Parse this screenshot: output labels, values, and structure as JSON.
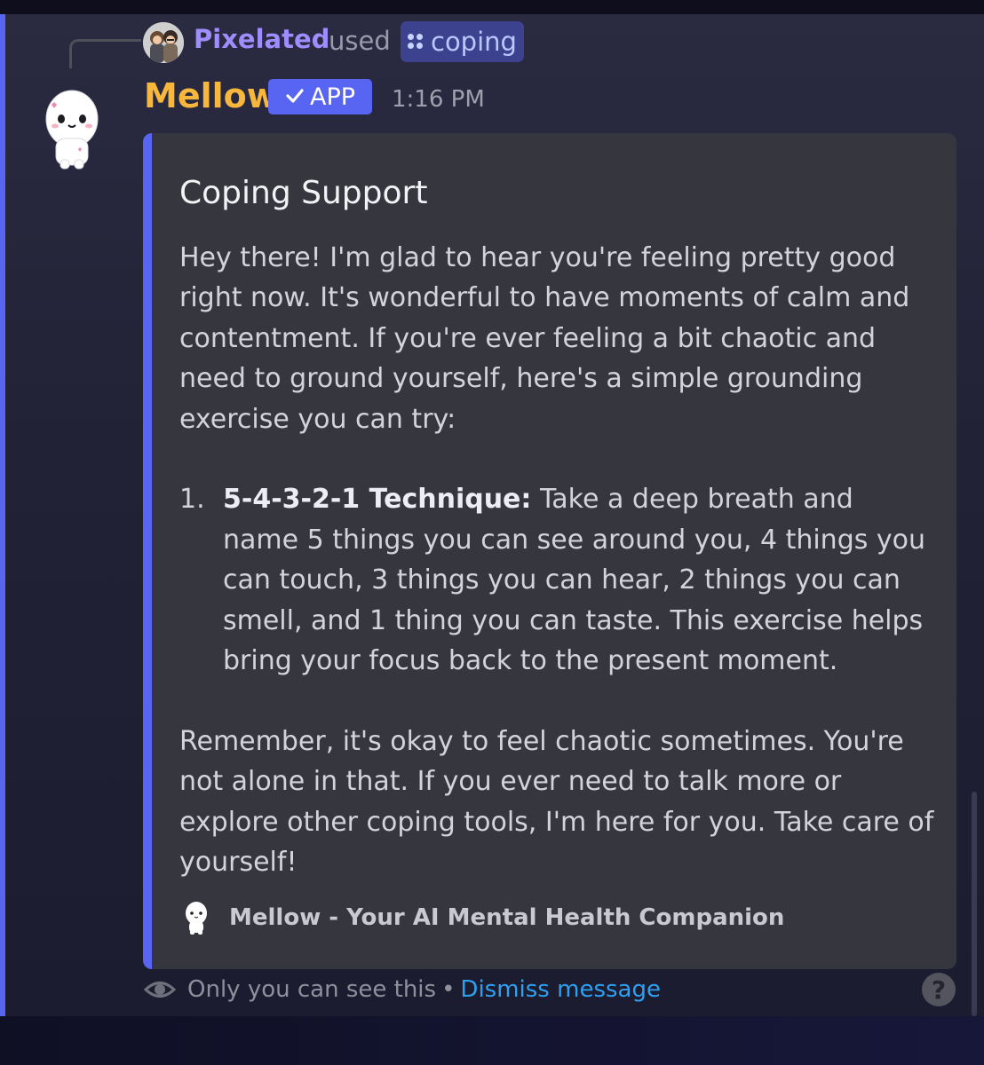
{
  "reply": {
    "user_name": "Pixelated",
    "used_text": "used",
    "command_name": "coping",
    "command_icon": "slash-command-icon"
  },
  "message": {
    "author": "Mellow",
    "badge": "APP",
    "timestamp": "1:16 PM",
    "author_color": "#f6b73c"
  },
  "embed": {
    "accent_color": "#5865f2",
    "title": "Coping Support",
    "intro": "Hey there! I'm glad to hear you're feeling pretty good right now. It's wonderful to have moments of calm and contentment. If you're ever feeling a bit chaotic and need to ground yourself, here's a simple grounding exercise you can try:",
    "list": [
      {
        "number": "1.",
        "bold": "5-4-3-2-1 Technique:",
        "text": " Take a deep breath and name 5 things you can see around you, 4 things you can touch, 3 things you can hear, 2 things you can smell, and 1 thing you can taste. This exercise helps bring your focus back to the present moment."
      }
    ],
    "closing": "Remember, it's okay to feel chaotic sometimes. You're not alone in that. If you ever need to talk more or explore other coping tools, I'm here for you. Take care of yourself!",
    "footer": "Mellow - Your AI Mental Health Companion"
  },
  "ephemeral": {
    "notice": "Only you can see this",
    "separator": "•",
    "dismiss_label": "Dismiss message",
    "help_label": "?"
  }
}
